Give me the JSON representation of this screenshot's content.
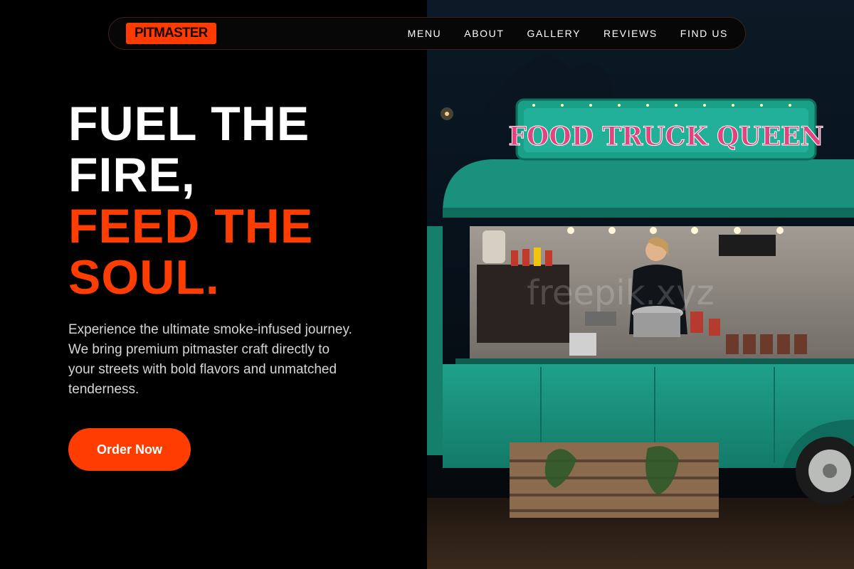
{
  "brand": {
    "logo_text": "PITMASTER"
  },
  "nav": {
    "links": [
      "MENU",
      "ABOUT",
      "GALLERY",
      "REVIEWS",
      "FIND US"
    ]
  },
  "hero": {
    "headline_line1": "FUEL THE",
    "headline_line2": "FIRE,",
    "headline_line3": "FEED THE",
    "headline_line4": "SOUL.",
    "description": "Experience the ultimate smoke-infused journey. We bring premium pitmaster craft directly to your streets with bold flavors and unmatched tenderness.",
    "cta_label": "Order Now"
  },
  "image": {
    "truck_sign": "FOOD TRUCK QUEEN",
    "watermark": "freepik.xyz"
  },
  "colors": {
    "accent": "#ff3d00",
    "truck": "#1c9a85",
    "background": "#000000"
  }
}
